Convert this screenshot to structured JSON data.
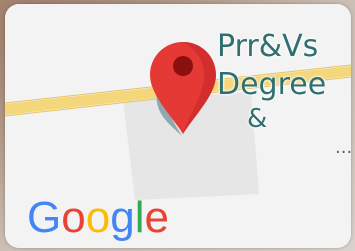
{
  "map": {
    "place_label": {
      "line1": "Prr&Vs",
      "line2": "Degree",
      "line3": "&",
      "line4": "..."
    },
    "logo_text": "Google",
    "colors": {
      "road": "#f3d77a",
      "land": "#f3f3f3",
      "building": "#e6e6e6",
      "pin": "#e53935",
      "pin_center": "#8b1010",
      "label": "#2f6f70",
      "logo_blue": "#4285F4",
      "logo_red": "#EA4335",
      "logo_yellow": "#FBBC05",
      "logo_green": "#34A853"
    },
    "icons": {
      "pin": "map-pin-icon"
    }
  }
}
